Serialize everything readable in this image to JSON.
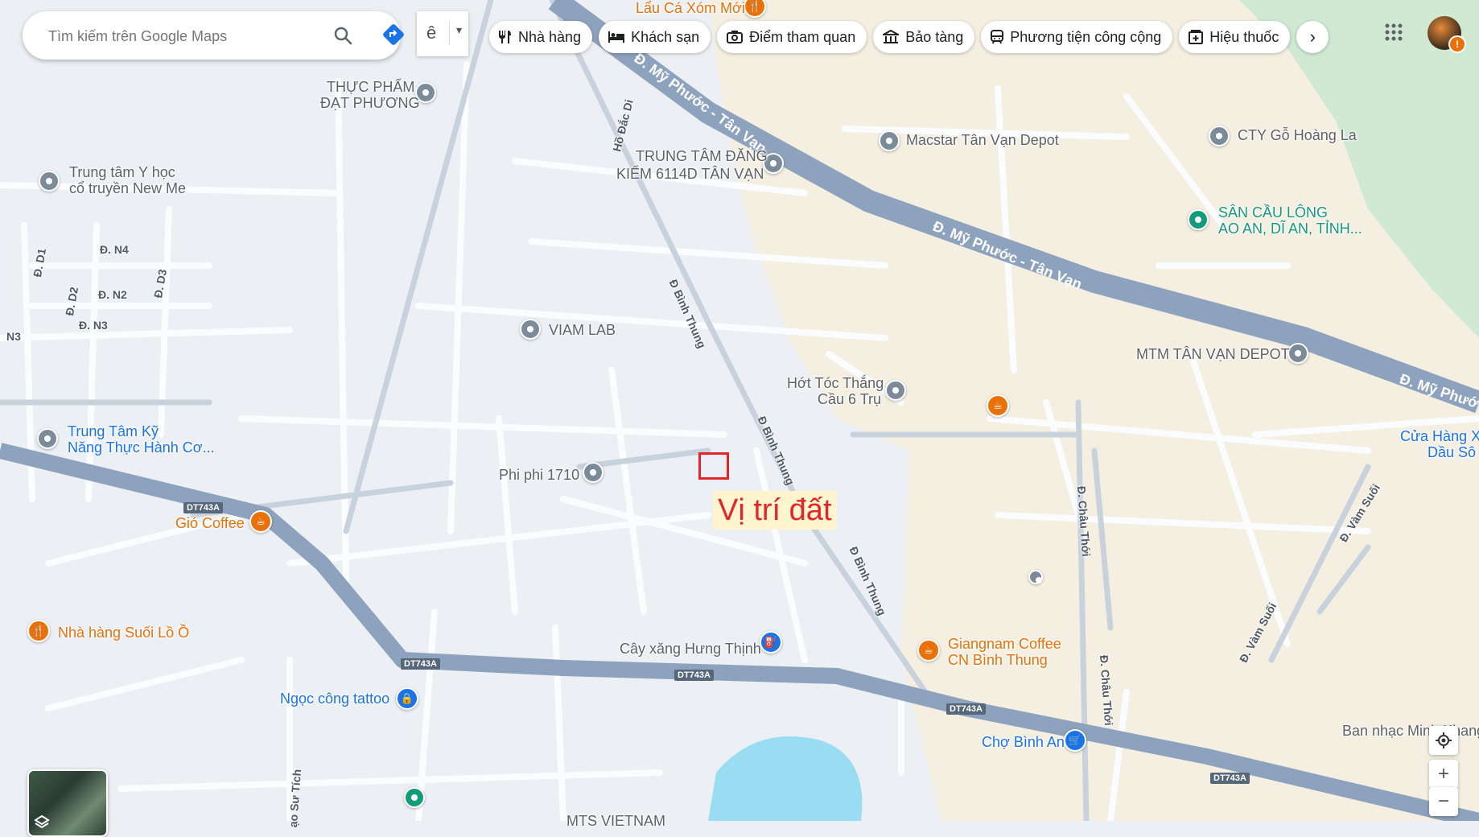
{
  "search": {
    "placeholder": "Tìm kiếm trên Google Maps",
    "lang_glyph": "ê"
  },
  "chips": [
    {
      "label": "Nhà hàng",
      "icon": "restaurant-icon"
    },
    {
      "label": "Khách sạn",
      "icon": "hotel-icon"
    },
    {
      "label": "Điểm tham quan",
      "icon": "camera-icon"
    },
    {
      "label": "Bảo tàng",
      "icon": "museum-icon"
    },
    {
      "label": "Phương tiện công cộng",
      "icon": "transit-icon"
    },
    {
      "label": "Hiệu thuốc",
      "icon": "pharmacy-icon"
    }
  ],
  "marker": {
    "label": "Vị trí đất",
    "color": "#e3242b"
  },
  "places": {
    "lau_ca": "Lẩu Cá Xóm Mới",
    "thuc_pham_1": "THỰC PHẨM",
    "thuc_pham_2": "ĐẠT PHƯƠNG",
    "trung_tam_dang_kiem_1": "TRUNG TÂM ĐĂNG",
    "trung_tam_dang_kiem_2": "KIỂM 6114D TÂN VẠN",
    "macstar": "Macstar Tân Vạn Depot",
    "cty_go": "CTY Gỗ Hoàng La",
    "san_cau_long_1": "SÂN CẦU LÔNG",
    "san_cau_long_2": "AO AN, DĨ AN, TỈNH...",
    "y_hoc_1": "Trung tâm Y học",
    "y_hoc_2": "cổ truyền New Me",
    "viam_lab": "VIAM LAB",
    "mtm": "MTM TÂN VẠN DEPOT",
    "hot_toc_1": "Hớt Tóc Thắng",
    "hot_toc_2": "Cầu 6 Trụ",
    "trung_tam_ky_1": "Trung Tâm Kỹ",
    "trung_tam_ky_2": "Năng Thực Hành Cơ...",
    "phi_phi": "Phi phi 1710",
    "gio_coffee": "Gió Coffee",
    "cua_hang_1": "Cửa Hàng Xe",
    "cua_hang_2": "Dầu Sô",
    "nha_hang_suoi": "Nhà hàng Suối Lồ Ồ",
    "cay_xang": "Cây xăng Hưng Thịnh",
    "giangnam_1": "Giangnam Coffee",
    "giangnam_2": "CN Bình Thung",
    "ngoc_tattoo": "Ngọc công tattoo",
    "cho_binh_an": "Chợ Bình An",
    "ban_nhac": "Ban nhạc Minh Khang",
    "mts_vietnam": "MTS VIETNAM"
  },
  "roads": {
    "my_phuoc_tan_van": "Đ. Mỹ Phước - Tân Vạn",
    "my_phuoc_tan_van_2": "Đ. Mỹ Phước - Tân Vạn",
    "my_phuoc_short": "Đ. Mỹ Phướ",
    "binh_thung": "Đ Bình Thung",
    "binh_thung_2": "Đ Bình Thung",
    "binh_thung_3": "Đ Bình Thung",
    "chau_thoi": "Đ. Châu Thới",
    "chau_thoi_2": "Đ. Châu Thới",
    "vam_suoi": "Đ. Vàm Suối",
    "vam_suoi_2": "Đ. Vàm Suối",
    "ho_dac_di": "Hồ Đắc Di",
    "n4": "Đ. N4",
    "n2": "Đ. N2",
    "n3": "Đ. N3",
    "n3_left": "N3",
    "d1": "Đ. D1",
    "d2": "Đ. D2",
    "d3": "Đ. D3",
    "su_tich": "ạo Sư Tích",
    "dt743a": "DT743A"
  },
  "colors": {
    "major_road": "#8da2bd",
    "land": "#eceff3",
    "urban": "#f5eedd",
    "park": "#cde9d2",
    "water": "#9adcf1"
  }
}
